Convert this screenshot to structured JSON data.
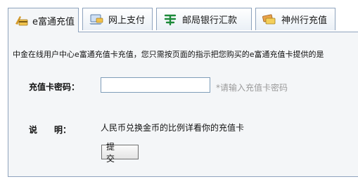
{
  "tabs": [
    {
      "label": "e富通充值",
      "icon": "bank-card-icon",
      "active": true
    },
    {
      "label": "网上支付",
      "icon": "laptop-card-icon",
      "active": false
    },
    {
      "label": "邮局银行汇款",
      "icon": "post-office-icon",
      "active": false
    },
    {
      "label": "神州行充值",
      "icon": "card-stack-icon",
      "active": false
    }
  ],
  "notice": "中金在线用户中心e富通充值卡充值，您只需按页面的指示把您购买的e富通充值卡提供的是",
  "form": {
    "password_label": "充值卡密码：",
    "password_value": "",
    "password_hint": "*请输入充值卡密码",
    "desc_label": "说　　明：",
    "desc_value": "人民币兑换金币的比例详看你的充值卡",
    "submit_label": "提 交"
  },
  "colors": {
    "tab_border": "#8ea3bd",
    "panel_bg": "#f4f6f8",
    "hint_text": "#9a9a9a",
    "post_icon_green": "#1c8a3a"
  }
}
